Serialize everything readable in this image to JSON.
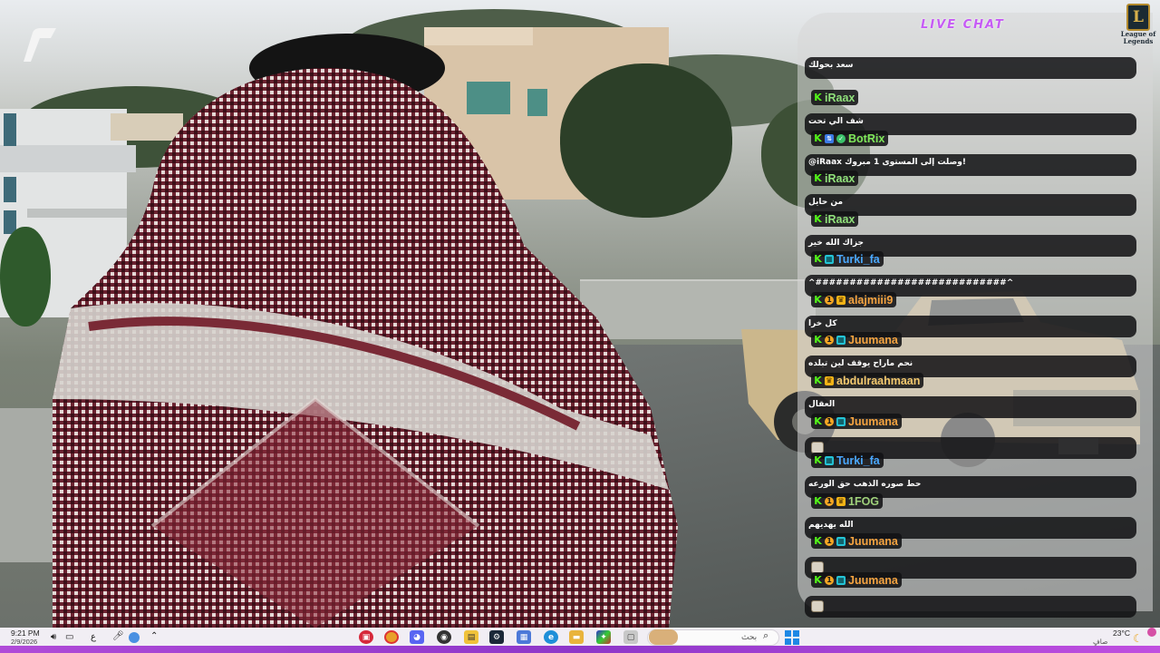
{
  "chat": {
    "title": "LIVE CHAT",
    "logo_text_line1": "League of",
    "logo_text_line2": "Legends",
    "messages": [
      {
        "text": "سعد بحولك"
      },
      {
        "user": "iRaax",
        "color": "#8fe07a",
        "badges": [
          "kick"
        ],
        "text": "شف الي تحت"
      },
      {
        "user": "BotRix",
        "color": "#7fe85a",
        "badges": [
          "kick",
          "bot",
          "verified"
        ],
        "text": "@iRaax وصلت إلى المستوى 1 مبروك!"
      },
      {
        "user": "iRaax",
        "color": "#8fe07a",
        "badges": [
          "kick"
        ],
        "text": "من حايل"
      },
      {
        "user": "iRaax",
        "color": "#8fe07a",
        "badges": [
          "kick"
        ],
        "text": "جزاك الله خير"
      },
      {
        "user": "Turki_fa",
        "color": "#4aa8ff",
        "badges": [
          "kick",
          "sub"
        ],
        "text": "^############################^"
      },
      {
        "user": "alajmiii9",
        "color": "#f5a340",
        "badges": [
          "kick",
          "gift",
          "crown"
        ],
        "text": "كل خرا"
      },
      {
        "user": "Juumana",
        "color": "#f5a340",
        "badges": [
          "kick",
          "gift",
          "sub"
        ],
        "text": "نحم ماراح يوقف لين تبلده"
      },
      {
        "user": "abdulraahmaan",
        "color": "#f2c86e",
        "badges": [
          "kick",
          "crown"
        ],
        "text": "العقال"
      },
      {
        "user": "Juumana",
        "color": "#f5a340",
        "badges": [
          "kick",
          "gift",
          "sub"
        ],
        "emote": true
      },
      {
        "user": "Turki_fa",
        "color": "#4aa8ff",
        "badges": [
          "kick",
          "sub"
        ],
        "text": "حط صوره الذهب حق الورعه"
      },
      {
        "user": "1FOG",
        "color": "#9ed07a",
        "badges": [
          "kick",
          "gift",
          "crown"
        ],
        "text": "الله يهديهم"
      },
      {
        "user": "Juumana",
        "color": "#f5a340",
        "badges": [
          "kick",
          "gift",
          "sub"
        ],
        "emote": true
      },
      {
        "user": "Juumana",
        "color": "#f5a340",
        "badges": [
          "kick",
          "gift",
          "sub"
        ],
        "emote": true
      }
    ]
  },
  "taskbar": {
    "time": "9:21 PM",
    "date": "2/9/2026",
    "lang": "ع",
    "search_placeholder": "بحث",
    "weather_temp": "23°C",
    "weather_label": "صافٍ"
  },
  "colors": {
    "accent": "#a844d6",
    "chat_title": "#c65bf5",
    "kick_green": "#53fc18"
  }
}
